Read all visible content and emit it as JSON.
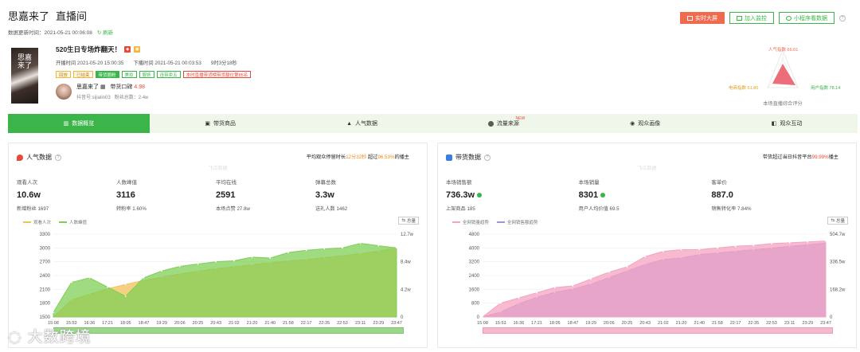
{
  "header": {
    "title": "思嘉来了",
    "subtitle": "直播间",
    "update_label": "数据更新时间：2021-05-21 00:06:08",
    "refresh_label": "刷新",
    "buttons": {
      "realtime": "实时大屏",
      "monitor": "加入监控",
      "miniapp": "小程序看数据"
    }
  },
  "live": {
    "cover_text": "思嘉来了",
    "title": "520生日专场炸翻天！",
    "start": "开播时间 2021-05-20 15:00:35",
    "end": "下播时间 2021-05-21 00:03:53",
    "duration": "9时3分18秒",
    "tags": [
      "回放",
      "已结束",
      "带货圈粉",
      "美妆",
      "服饰",
      "连带卖五",
      "本时直播带货榜带货额位第85名"
    ],
    "anchor_name": "思嘉来了",
    "anchor_badge": "带货口碑",
    "anchor_score": "4.98",
    "anchor_id": "抖音号:sijialin03",
    "fans": "粉丝总数：2.4w"
  },
  "radar": {
    "top": "人气指数 66.01",
    "left": "电商指数 61.80",
    "right": "用户指数 78.14",
    "caption": "本场直播综合评分",
    "colors": {
      "top": "#f06a4f",
      "left": "#f1b73a",
      "right": "#3bb54a"
    }
  },
  "tabs": [
    {
      "label": "数据概览",
      "active": true
    },
    {
      "label": "带货商品"
    },
    {
      "label": "人气数据"
    },
    {
      "label": "流量来源",
      "new": "NEW"
    },
    {
      "label": "观众画像"
    },
    {
      "label": "观众互动"
    }
  ],
  "popularity": {
    "title": "人气数据",
    "note_pre": "平均观众停留时长",
    "note_val": "12分32秒",
    "note_mid": " 超过",
    "note_pct": "96.53%",
    "note_post": "的播主",
    "watermark": "飞瓜数据",
    "metrics": [
      {
        "label": "观看人次",
        "value": "10.6w",
        "sub": "新增粉丝 1697"
      },
      {
        "label": "人数峰值",
        "value": "3116",
        "sub": "转粉率 1.60%"
      },
      {
        "label": "平均在线",
        "value": "2591",
        "sub": "本场点赞 27.8w"
      },
      {
        "label": "弹幕总数",
        "value": "3.3w",
        "sub": "送礼人数 1462"
      }
    ],
    "legend": [
      "观看人次",
      "人数峰值"
    ],
    "total_label": "总量"
  },
  "sales": {
    "title": "带货数据",
    "note_pre": "带货超过当日抖音平台",
    "note_pct": "99.99%",
    "note_post": "播主",
    "watermark": "飞瓜数据",
    "metrics": [
      {
        "label": "本场销售额",
        "value": "736.3w",
        "sub": "上架商品 185",
        "verified": true
      },
      {
        "label": "本场销量",
        "value": "8301",
        "sub": "用户人均价值 69.5",
        "verified": true
      },
      {
        "label": "客单价",
        "value": "887.0",
        "sub": "销售转化率 7.84%"
      }
    ],
    "legend": [
      "全网销量趋势",
      "全网销售额趋势"
    ],
    "total_label": "总量"
  },
  "chart_data": [
    {
      "type": "area",
      "title": "人气数据",
      "x": [
        "15:08",
        "15:53",
        "16:36",
        "17:21",
        "18:05",
        "18:47",
        "19:29",
        "20:06",
        "20:25",
        "20:43",
        "21:02",
        "21:20",
        "21:40",
        "21:58",
        "22:17",
        "22:35",
        "22:53",
        "23:11",
        "23:29",
        "23:47"
      ],
      "ylim_left": [
        1500,
        3300
      ],
      "yticks_left": [
        1500,
        1800,
        2100,
        2400,
        2700,
        3000,
        3300
      ],
      "yticks_right": [
        "0",
        "4.2w",
        "8.4w",
        "12.7w"
      ],
      "series": [
        {
          "name": "人数峰值",
          "axis": "left",
          "values": [
            1600,
            2250,
            2350,
            2150,
            1950,
            2350,
            2500,
            2600,
            2650,
            2700,
            2720,
            2800,
            2780,
            2900,
            2950,
            2980,
            3000,
            3100,
            3050,
            3000
          ],
          "color": "#7fcf55"
        },
        {
          "name": "观看人次",
          "axis": "right",
          "values": [
            0,
            2.6,
            3.5,
            4.3,
            5.0,
            5.6,
            6.1,
            6.6,
            7.0,
            7.4,
            7.7,
            8.0,
            8.3,
            8.6,
            8.8,
            9.1,
            9.4,
            9.7,
            10.1,
            10.6
          ],
          "color": "#f3c15a"
        }
      ]
    },
    {
      "type": "area",
      "title": "带货数据",
      "x": [
        "15:08",
        "15:53",
        "16:36",
        "17:21",
        "18:05",
        "18:47",
        "19:29",
        "20:06",
        "20:25",
        "20:43",
        "21:02",
        "21:20",
        "21:40",
        "21:58",
        "22:17",
        "22:35",
        "22:53",
        "23:11",
        "23:29",
        "23:47"
      ],
      "ylim_left": [
        0,
        4800
      ],
      "yticks_left": [
        0,
        800,
        1600,
        2400,
        3200,
        4000,
        4800
      ],
      "yticks_right": [
        "0",
        "168.2w",
        "336.5w",
        "504.7w"
      ],
      "series": [
        {
          "name": "全网销量趋势",
          "axis": "left",
          "values": [
            0,
            800,
            1100,
            1400,
            1700,
            1800,
            2200,
            2600,
            2900,
            3500,
            3800,
            3900,
            3900,
            4000,
            4100,
            4150,
            4250,
            4300,
            4350,
            4400
          ],
          "color": "#f5a3c0"
        },
        {
          "name": "全网销售额趋势",
          "axis": "right",
          "values": [
            0,
            30,
            80,
            120,
            150,
            170,
            200,
            240,
            280,
            320,
            350,
            360,
            380,
            390,
            400,
            410,
            420,
            430,
            440,
            450
          ],
          "color": "#a98de0"
        }
      ]
    }
  ],
  "brand": "大数跨境"
}
